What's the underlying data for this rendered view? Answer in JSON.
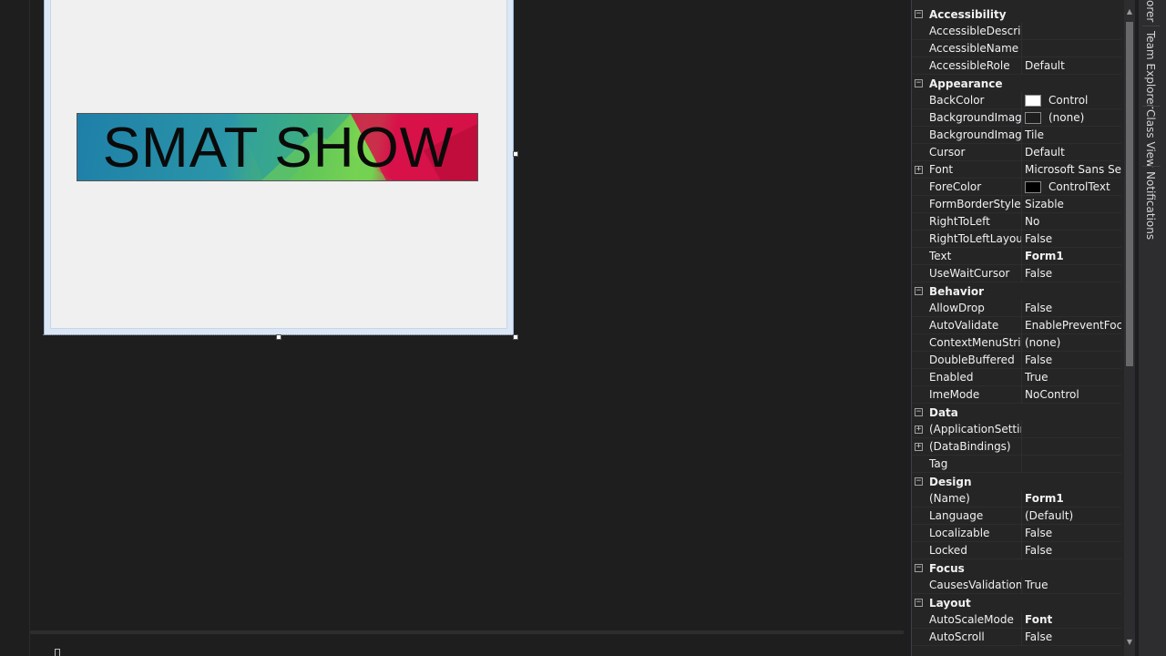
{
  "designer": {
    "banner_text": "SMAT SHOW"
  },
  "properties": {
    "rows": [
      {
        "type": "cat",
        "name": "Accessibility",
        "icon": "minus"
      },
      {
        "type": "prop",
        "name": "AccessibleDescripti",
        "value": ""
      },
      {
        "type": "prop",
        "name": "AccessibleName",
        "value": ""
      },
      {
        "type": "prop",
        "name": "AccessibleRole",
        "value": "Default"
      },
      {
        "type": "cat",
        "name": "Appearance",
        "icon": "minus"
      },
      {
        "type": "prop",
        "name": "BackColor",
        "value": "Control",
        "swatch": "#ffffff"
      },
      {
        "type": "prop",
        "name": "BackgroundImage",
        "value": "(none)",
        "swatch": "#1e1e1e"
      },
      {
        "type": "prop",
        "name": "BackgroundImagel",
        "value": "Tile"
      },
      {
        "type": "prop",
        "name": "Cursor",
        "value": "Default"
      },
      {
        "type": "prop",
        "name": "Font",
        "value": "Microsoft Sans Serif,",
        "icon": "plus"
      },
      {
        "type": "prop",
        "name": "ForeColor",
        "value": "ControlText",
        "swatch": "#000000"
      },
      {
        "type": "prop",
        "name": "FormBorderStyle",
        "value": "Sizable"
      },
      {
        "type": "prop",
        "name": "RightToLeft",
        "value": "No"
      },
      {
        "type": "prop",
        "name": "RightToLeftLayout",
        "value": "False"
      },
      {
        "type": "prop",
        "name": "Text",
        "value": "Form1",
        "bold": true
      },
      {
        "type": "prop",
        "name": "UseWaitCursor",
        "value": "False"
      },
      {
        "type": "cat",
        "name": "Behavior",
        "icon": "minus"
      },
      {
        "type": "prop",
        "name": "AllowDrop",
        "value": "False"
      },
      {
        "type": "prop",
        "name": "AutoValidate",
        "value": "EnablePreventFocus"
      },
      {
        "type": "prop",
        "name": "ContextMenuStrip",
        "value": "(none)"
      },
      {
        "type": "prop",
        "name": "DoubleBuffered",
        "value": "False"
      },
      {
        "type": "prop",
        "name": "Enabled",
        "value": "True"
      },
      {
        "type": "prop",
        "name": "ImeMode",
        "value": "NoControl"
      },
      {
        "type": "cat",
        "name": "Data",
        "icon": "minus"
      },
      {
        "type": "prop",
        "name": "(ApplicationSetting",
        "value": "",
        "icon": "plus"
      },
      {
        "type": "prop",
        "name": "(DataBindings)",
        "value": "",
        "icon": "plus"
      },
      {
        "type": "prop",
        "name": "Tag",
        "value": ""
      },
      {
        "type": "cat",
        "name": "Design",
        "icon": "minus"
      },
      {
        "type": "prop",
        "name": "(Name)",
        "value": "Form1",
        "bold": true
      },
      {
        "type": "prop",
        "name": "Language",
        "value": "(Default)"
      },
      {
        "type": "prop",
        "name": "Localizable",
        "value": "False"
      },
      {
        "type": "prop",
        "name": "Locked",
        "value": "False"
      },
      {
        "type": "cat",
        "name": "Focus",
        "icon": "minus"
      },
      {
        "type": "prop",
        "name": "CausesValidation",
        "value": "True"
      },
      {
        "type": "cat",
        "name": "Layout",
        "icon": "minus"
      },
      {
        "type": "prop",
        "name": "AutoScaleMode",
        "value": "Font",
        "bold": true
      },
      {
        "type": "prop",
        "name": "AutoScroll",
        "value": "False"
      }
    ]
  },
  "side_tabs": {
    "top_fragment": "orer",
    "team_explorer": "Team Explorer",
    "class_view": "Class View",
    "notifications": "Notifications"
  },
  "colors": {
    "background": "#1e1e1e",
    "panel": "#252526",
    "text": "#f1f1f1",
    "accent": "#3794ff"
  }
}
